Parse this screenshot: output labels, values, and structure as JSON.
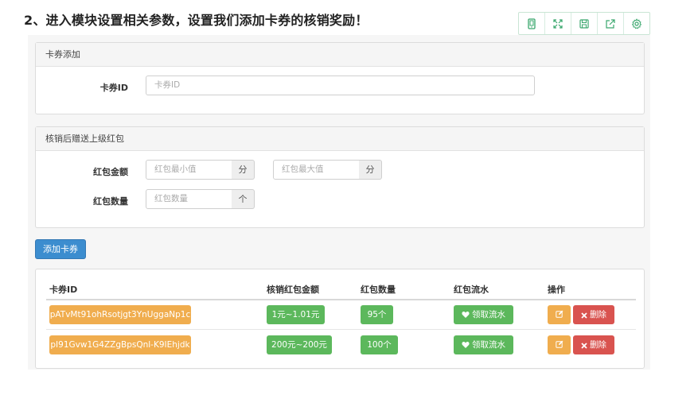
{
  "heading": "2、进入模块设置相关参数，设置我们添加卡券的核销奖励！",
  "toolbar": {
    "icons": [
      "mobile-icon",
      "fullscreen-icon",
      "save-icon",
      "share-icon",
      "settings-icon"
    ]
  },
  "coupon_panel": {
    "title": "卡券添加",
    "coupon_id_label": "卡券ID",
    "coupon_id_placeholder": "卡券ID"
  },
  "reward_panel": {
    "title": "核销后赠送上级红包",
    "amount_label": "红包金额",
    "min_placeholder": "红包最小值",
    "max_placeholder": "红包最大值",
    "unit_fen": "分",
    "count_label": "红包数量",
    "count_placeholder": "红包数量",
    "unit_ge": "个"
  },
  "add_button": "添加卡券",
  "table": {
    "headers": [
      "卡券ID",
      "核销红包金额",
      "红包数量",
      "红包流水",
      "操作"
    ],
    "rows": [
      {
        "coupon_id": "pATvMt91ohRsotjgt3YnUggaNp1c",
        "amount": "1元~1.01元",
        "count": "95个",
        "flow": "领取流水",
        "delete": "删除"
      },
      {
        "coupon_id": "pI91Gvw1G4ZZgBpsQnl-K9IEhjdk",
        "amount": "200元~200元",
        "count": "100个",
        "flow": "领取流水",
        "delete": "删除"
      }
    ]
  },
  "colors": {
    "primary": "#3c8dcf",
    "warning": "#f0ad4e",
    "success": "#5cb85c",
    "danger": "#d9534f",
    "toolbar_icon": "#3aa76d"
  }
}
